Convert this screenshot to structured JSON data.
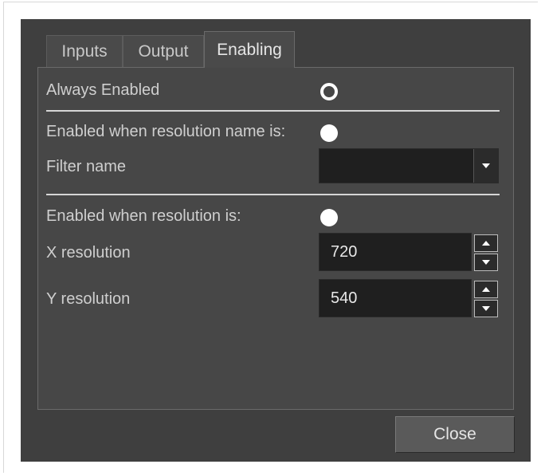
{
  "tabs": [
    {
      "label": "Inputs"
    },
    {
      "label": "Output"
    },
    {
      "label": "Enabling"
    }
  ],
  "active_tab": "Enabling",
  "always_enabled": {
    "label": "Always Enabled",
    "selected": true
  },
  "resolution_name": {
    "label": "Enabled when resolution name is:",
    "selected": false,
    "filter_label": "Filter name",
    "filter_value": ""
  },
  "resolution": {
    "label": "Enabled when resolution is:",
    "selected": false,
    "x_label": "X resolution",
    "x_value": "720",
    "y_label": "Y resolution",
    "y_value": "540"
  },
  "footer": {
    "close_label": "Close"
  },
  "icons": {
    "dropdown": "chevron-down-icon",
    "spin_up": "arrow-up-icon",
    "spin_down": "arrow-down-icon"
  },
  "colors": {
    "dialog_bg": "#3f3f3f",
    "panel_bg": "#474747",
    "field_bg": "#1f1f1f",
    "radio": "#ffffff"
  }
}
